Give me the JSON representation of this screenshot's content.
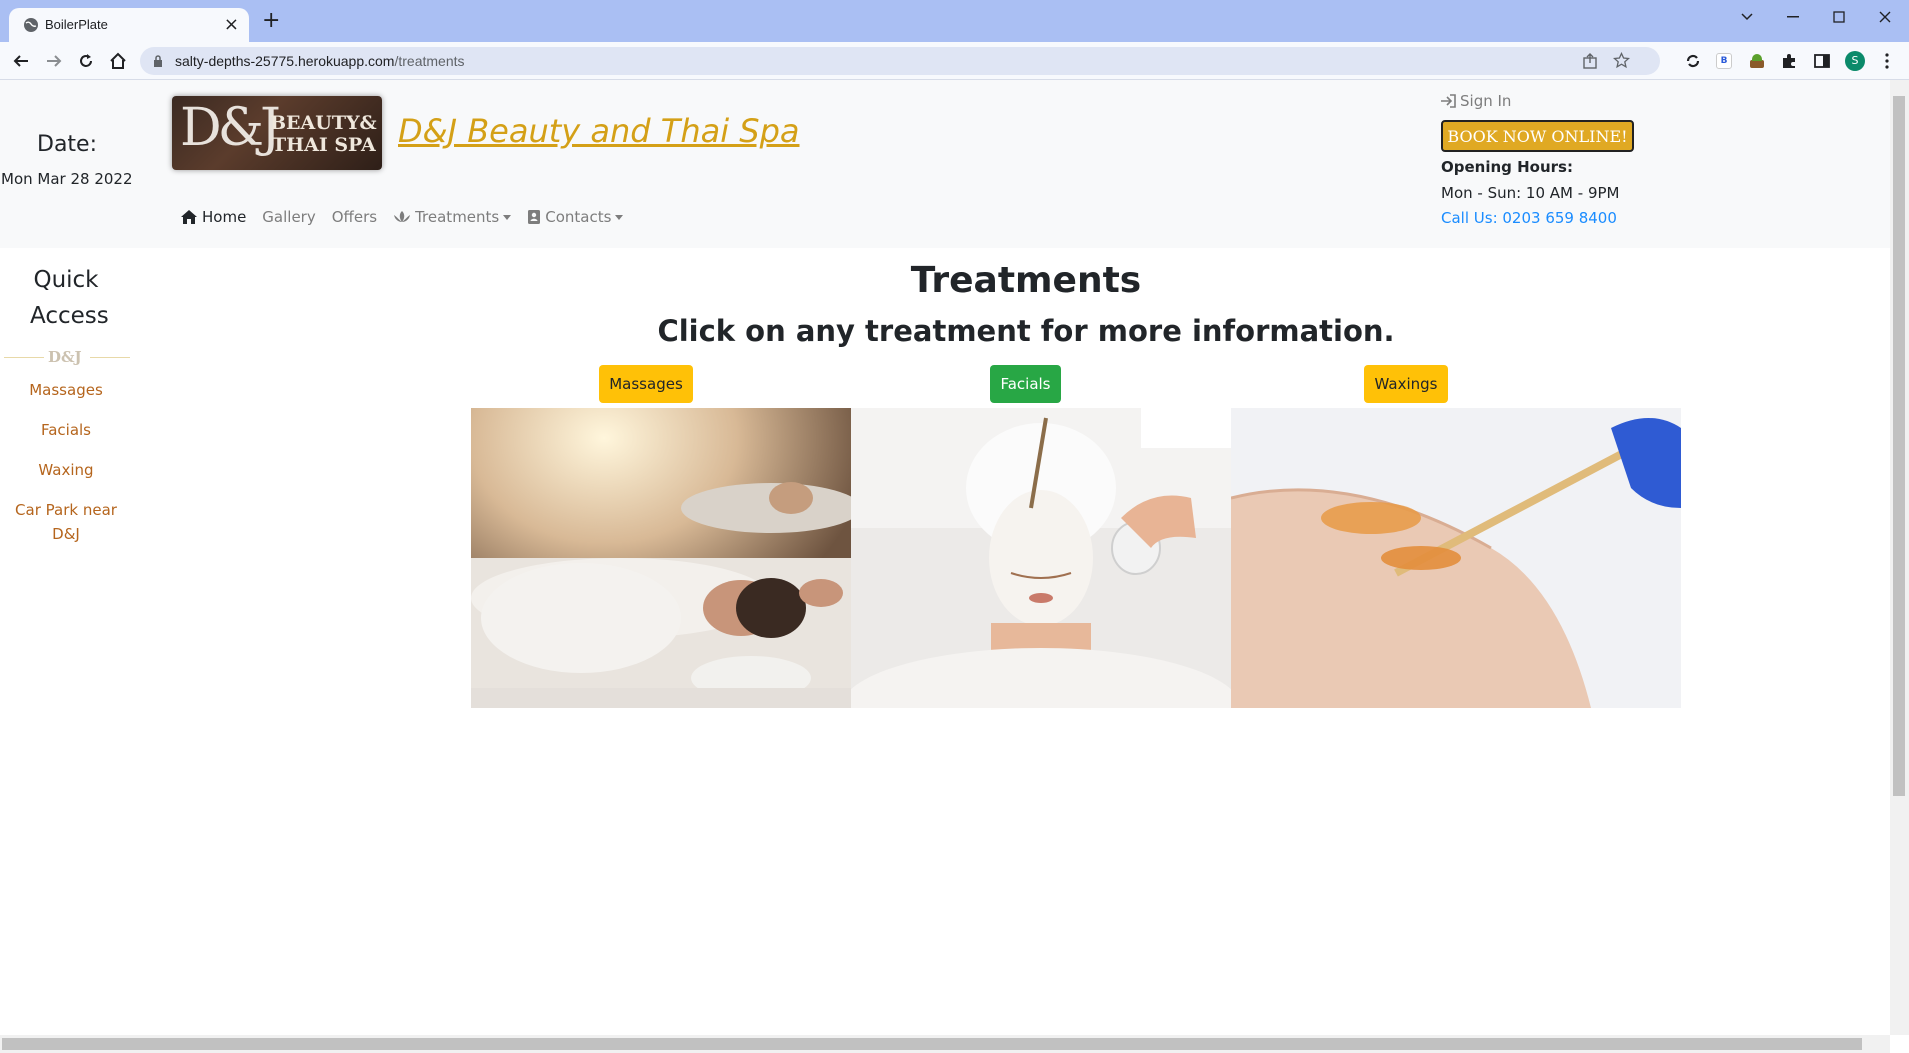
{
  "browser": {
    "tab_title": "BoilerPlate",
    "tab_close": "×",
    "new_tab": "+",
    "url_host": "salty-depths-25775.herokuapp.com",
    "url_path": "/treatments",
    "profile_initial": "S"
  },
  "header": {
    "date_label": "Date:",
    "date_value": "Mon Mar 28 2022",
    "logo_mark": "D&J",
    "logo_line1": "BEAUTY&",
    "logo_line2": "THAI SPA",
    "site_title": "D&J Beauty and Thai Spa",
    "nav": {
      "home": "Home",
      "gallery": "Gallery",
      "offers": "Offers",
      "treatments": "Treatments",
      "contacts": "Contacts"
    },
    "sign_in": "Sign In",
    "book_button": "BOOK NOW ONLINE!",
    "hours_title": "Opening Hours:",
    "hours_value": "Mon - Sun: 10 AM - 9PM",
    "call_us": "Call Us: 0203 659 8400"
  },
  "sidebar": {
    "title": "Quick Access",
    "divider": "D&J",
    "links": [
      "Massages",
      "Facials",
      "Waxing",
      "Car Park near D&J"
    ]
  },
  "main": {
    "title": "Treatments",
    "subtitle": "Click on any treatment for more information.",
    "treatments": [
      {
        "label": "Massages",
        "color": "#ffc107"
      },
      {
        "label": "Facials",
        "color": "#28a745"
      },
      {
        "label": "Waxings",
        "color": "#ffc107"
      }
    ]
  },
  "colors": {
    "accent_gold": "#d4a017",
    "link_brown": "#b5651d",
    "link_blue": "#1a8cff"
  }
}
